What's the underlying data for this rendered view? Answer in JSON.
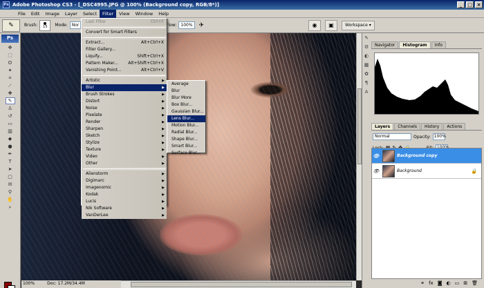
{
  "window": {
    "title": "Adobe Photoshop CS3 - [_DSC4995.JPG @ 100% (Background copy, RGB/8*)]",
    "app_icon": "Ps",
    "buttons": [
      "_",
      "□",
      "×"
    ]
  },
  "menubar": {
    "items": [
      "File",
      "Edit",
      "Image",
      "Layer",
      "Select",
      "Filter",
      "View",
      "Window",
      "Help"
    ],
    "active": "Filter"
  },
  "options": {
    "brush_label": "Brush:",
    "brush_size": "15",
    "mode_label": "Mode:",
    "mode_value": "Nor",
    "flow_label": "Flow:",
    "flow_value": "100%",
    "workspace_label": "Workspace ▾"
  },
  "filter_menu": {
    "items": [
      {
        "label": "Last Filter",
        "shortcut": "Ctrl+F",
        "disabled": true
      },
      {
        "sep": true
      },
      {
        "label": "Convert for Smart Filters"
      },
      {
        "sep": true
      },
      {
        "label": "Extract...",
        "shortcut": "Alt+Ctrl+X"
      },
      {
        "label": "Filter Gallery..."
      },
      {
        "label": "Liquify...",
        "shortcut": "Shift+Ctrl+X"
      },
      {
        "label": "Pattern Maker...",
        "shortcut": "Alt+Shift+Ctrl+X"
      },
      {
        "label": "Vanishing Point...",
        "shortcut": "Alt+Ctrl+V"
      },
      {
        "sep": true
      },
      {
        "label": "Artistic",
        "sub": true
      },
      {
        "label": "Blur",
        "sub": true,
        "highlight": true
      },
      {
        "label": "Brush Strokes",
        "sub": true
      },
      {
        "label": "Distort",
        "sub": true
      },
      {
        "label": "Noise",
        "sub": true
      },
      {
        "label": "Pixelate",
        "sub": true
      },
      {
        "label": "Render",
        "sub": true
      },
      {
        "label": "Sharpen",
        "sub": true
      },
      {
        "label": "Sketch",
        "sub": true
      },
      {
        "label": "Stylize",
        "sub": true
      },
      {
        "label": "Texture",
        "sub": true
      },
      {
        "label": "Video",
        "sub": true
      },
      {
        "label": "Other",
        "sub": true
      },
      {
        "sep": true
      },
      {
        "label": "Alienstorm",
        "sub": true
      },
      {
        "label": "Digimarc",
        "sub": true
      },
      {
        "label": "Imagenomic",
        "sub": true
      },
      {
        "label": "Kodak",
        "sub": true
      },
      {
        "label": "Lucis",
        "sub": true
      },
      {
        "label": "Nik Software",
        "sub": true
      },
      {
        "label": "VanDerLee",
        "sub": true
      }
    ]
  },
  "blur_menu": {
    "items": [
      {
        "label": "Average"
      },
      {
        "label": "Blur"
      },
      {
        "label": "Blur More"
      },
      {
        "label": "Box Blur..."
      },
      {
        "label": "Gaussian Blur..."
      },
      {
        "label": "Lens Blur...",
        "highlight": true
      },
      {
        "label": "Motion Blur..."
      },
      {
        "label": "Radial Blur..."
      },
      {
        "label": "Shape Blur..."
      },
      {
        "label": "Smart Blur..."
      },
      {
        "label": "Surface Blur..."
      }
    ]
  },
  "status": {
    "zoom": "100%",
    "doc": "Doc: 17.2M/34.4M"
  },
  "navigator_panel": {
    "tabs": [
      "Navigator",
      "Histogram",
      "Info"
    ],
    "active": "Histogram"
  },
  "layers_panel": {
    "tabs": [
      "Layers",
      "Channels",
      "History",
      "Actions"
    ],
    "active": "Layers",
    "blend_mode": "Normal",
    "opacity_label": "Opacity:",
    "opacity": "100%",
    "lock_label": "Lock:",
    "fill_label": "Fill:",
    "fill": "100%",
    "layers": [
      {
        "name": "Background copy",
        "selected": true
      },
      {
        "name": "Background",
        "locked": true
      }
    ],
    "bottom_icons": [
      "link-icon",
      "fx-icon",
      "mask-icon",
      "adjustment-icon",
      "group-icon",
      "new-layer-icon",
      "trash-icon"
    ]
  },
  "colors": {
    "foreground": "#8b0000",
    "background": "#ffffff",
    "menu_highlight": "#0a246a",
    "layer_selected": "#3a8ee6"
  }
}
